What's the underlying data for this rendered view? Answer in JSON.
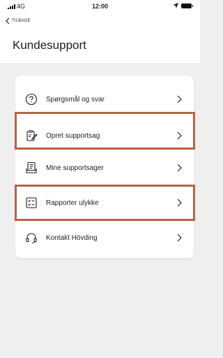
{
  "status_bar": {
    "network": "4G",
    "time": "12:00"
  },
  "nav": {
    "back_label": "TILBAGE"
  },
  "page": {
    "title": "Kundesupport"
  },
  "menu": {
    "items": [
      {
        "label": "Spørgsmål og svar",
        "icon": "question-circle-icon"
      },
      {
        "label": "Opret supportsag",
        "icon": "clipboard-edit-icon",
        "highlighted": true
      },
      {
        "label": "Mine supportsager",
        "icon": "document-stack-icon"
      },
      {
        "label": "Rapporter ulykke",
        "icon": "checklist-icon",
        "highlighted": true
      },
      {
        "label": "Kontakt Hövding",
        "icon": "headset-icon"
      }
    ]
  },
  "colors": {
    "highlight": "#b9624a",
    "background": "#efefef",
    "card": "#ffffff"
  }
}
